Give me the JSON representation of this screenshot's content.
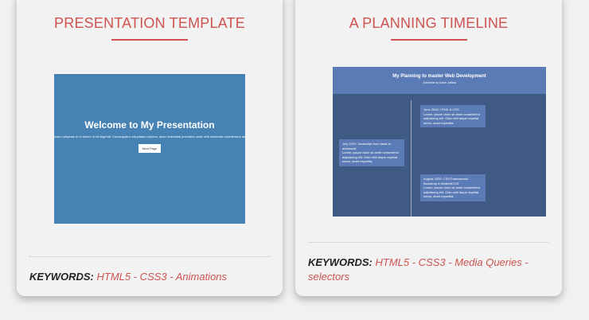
{
  "cards": [
    {
      "title": "PRESENTATION TEMPLATE",
      "keywords_label": "KEYWORDS:",
      "keywords": "HTML5 - CSS3 - Animations",
      "preview": {
        "heading": "Welcome to My Presentation",
        "text": "Iusto voluptate et in dicere id sit eligendi. Consequatur voluptates dolores, amet molestiae provident unde velit reiciendis repellendus harum iure",
        "button": "Next Page"
      }
    },
    {
      "title": "A PLANNING TIMELINE",
      "keywords_label": "KEYWORDS:",
      "keywords": "HTML5 - CSS3 - Media Queries - selectors",
      "preview": {
        "heading": "My Planning to master Web Development",
        "subtitle": "A timeline by Karim Jaffara",
        "items": [
          {
            "title": "June 2020: HTML & CSS",
            "text": "Lorem, ipsum dolor sit amet consectetur adipisicing elit. Odio nihil atque repellat nemo, amet expedita."
          },
          {
            "title": "July 2020: Javascript from basic to advanced",
            "text": "Lorem, ipsum dolor sit amet consectetur adipisicing elit. Odio nihil atque repellat nemo, amet expedita."
          },
          {
            "title": "August 2020: CSS Frameworks - Bootstrap & MaterialCSS",
            "text": "Lorem, ipsum dolor sit amet consectetur adipisicing elit. Odio nihil atque repellat nemo, amet expedita."
          }
        ]
      }
    }
  ],
  "colors": {
    "accent": "#cf5350",
    "preview1_bg": "#4682b4",
    "preview2_bg": "#3f5a85"
  }
}
